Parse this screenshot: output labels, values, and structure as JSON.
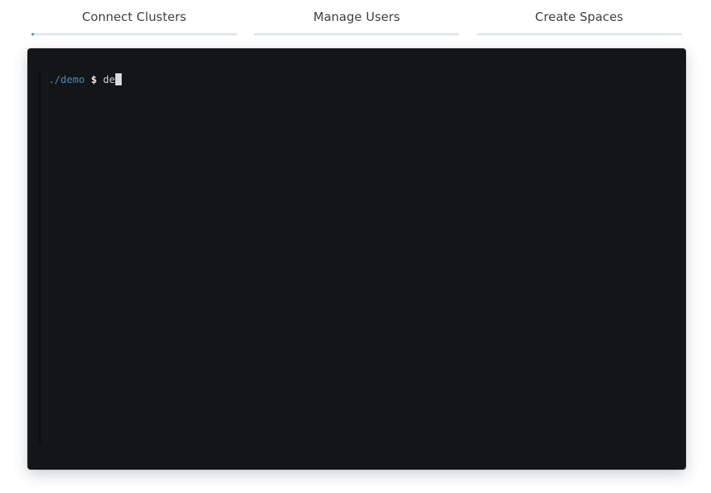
{
  "tabs": [
    {
      "label": "Connect Clusters",
      "progress": 0.01
    },
    {
      "label": "Manage Users",
      "progress": 0
    },
    {
      "label": "Create Spaces",
      "progress": 0
    }
  ],
  "terminal": {
    "prompt_path": "./demo",
    "prompt_symbol": "$",
    "command": "de"
  },
  "colors": {
    "terminal_background": "#141517",
    "prompt_path": "#3e8fc4",
    "progress_fill": "#9fd4e6",
    "progress_track": "#e2e7ec"
  }
}
